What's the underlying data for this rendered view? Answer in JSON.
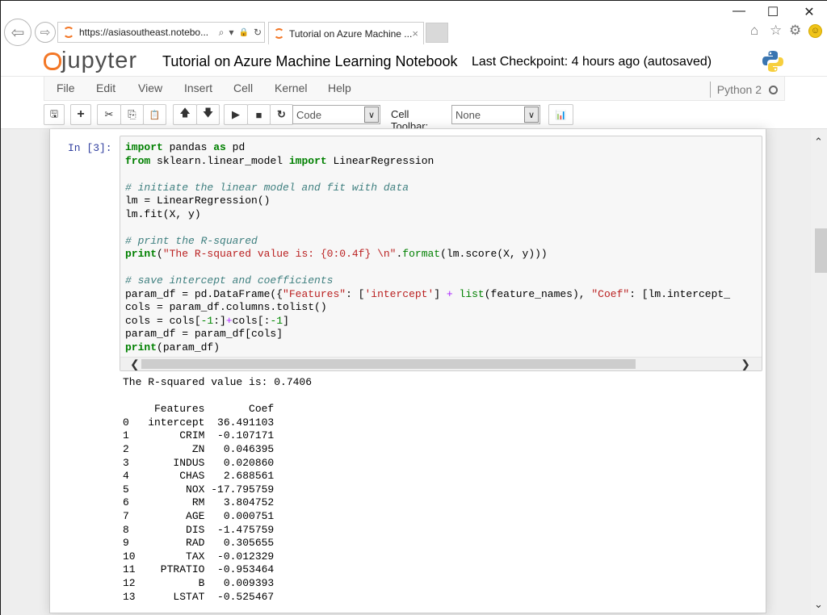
{
  "browser": {
    "url": "https://asiasoutheast.notebo...",
    "tab_title": "Tutorial on Azure Machine ...",
    "window_controls": {
      "minimize": "—",
      "maximize": "☐",
      "close": "✕"
    },
    "icons": {
      "back": "⇦",
      "forward": "⇨",
      "search": "⌕",
      "dropdown": "▾",
      "lock": "🔒",
      "refresh": "↻",
      "tab_close": "×",
      "home": "⌂",
      "favorites": "☆",
      "settings": "⚙",
      "feedback": "☺"
    }
  },
  "jupyter": {
    "logo_text": "jupyter",
    "notebook_title": "Tutorial on Azure Machine Learning Notebook",
    "checkpoint": "Last Checkpoint: 4 hours ago (autosaved)",
    "menu": [
      "File",
      "Edit",
      "View",
      "Insert",
      "Cell",
      "Kernel",
      "Help"
    ],
    "kernel_name": "Python 2",
    "toolbar": {
      "icons": {
        "save": "🖫",
        "add": "+",
        "cut": "✂",
        "copy": "⎘",
        "paste": "📋",
        "up": "🡅",
        "down": "🡇",
        "run": "▶",
        "stop": "■",
        "restart": "↻",
        "chart": "📊"
      },
      "cell_type": "Code",
      "cell_toolbar_label": "Cell Toolbar:",
      "cell_toolbar_value": "None",
      "dropdown_arrow": "∨"
    }
  },
  "cell": {
    "prompt": "In [3]:",
    "code_lines": [
      [
        {
          "t": "import",
          "c": "kw"
        },
        {
          "t": " pandas "
        },
        {
          "t": "as",
          "c": "kw"
        },
        {
          "t": " pd"
        }
      ],
      [
        {
          "t": "from",
          "c": "kw"
        },
        {
          "t": " sklearn.linear_model "
        },
        {
          "t": "import",
          "c": "kw"
        },
        {
          "t": " LinearRegression"
        }
      ],
      [],
      [
        {
          "t": "# initiate the linear model and fit with data",
          "c": "cm"
        }
      ],
      [
        {
          "t": "lm = LinearRegression()"
        }
      ],
      [
        {
          "t": "lm.fit(X, y)"
        }
      ],
      [],
      [
        {
          "t": "# print the R-squared",
          "c": "cm"
        }
      ],
      [
        {
          "t": "print",
          "c": "kw"
        },
        {
          "t": "("
        },
        {
          "t": "\"The R-squared value is: {0:0.4f} \\n\"",
          "c": "st"
        },
        {
          "t": "."
        },
        {
          "t": "format",
          "c": "nb"
        },
        {
          "t": "(lm.score(X, y)))"
        }
      ],
      [],
      [
        {
          "t": "# save intercept and coefficients",
          "c": "cm"
        }
      ],
      [
        {
          "t": "param_df = pd.DataFrame({"
        },
        {
          "t": "\"Features\"",
          "c": "st"
        },
        {
          "t": ": ["
        },
        {
          "t": "'intercept'",
          "c": "st"
        },
        {
          "t": "] "
        },
        {
          "t": "+",
          "c": "op"
        },
        {
          "t": " "
        },
        {
          "t": "list",
          "c": "nb"
        },
        {
          "t": "(feature_names), "
        },
        {
          "t": "\"Coef\"",
          "c": "st"
        },
        {
          "t": ": [lm.intercept_"
        }
      ],
      [
        {
          "t": "cols = param_df.columns.tolist()"
        }
      ],
      [
        {
          "t": "cols = cols["
        },
        {
          "t": "-1",
          "c": "nm"
        },
        {
          "t": ":]"
        },
        {
          "t": "+",
          "c": "op"
        },
        {
          "t": "cols[:"
        },
        {
          "t": "-1",
          "c": "nm"
        },
        {
          "t": "]"
        }
      ],
      [
        {
          "t": "param_df = param_df[cols]"
        }
      ],
      [
        {
          "t": "print",
          "c": "kw"
        },
        {
          "t": "(param_df)"
        }
      ]
    ],
    "hscroll": {
      "left": "❮",
      "right": "❯"
    },
    "output": {
      "r_squared_line": "The R-squared value is: 0.7406",
      "table_header": [
        "",
        "Features",
        "Coef"
      ],
      "rows": [
        [
          "0",
          "intercept",
          "36.491103"
        ],
        [
          "1",
          "CRIM",
          "-0.107171"
        ],
        [
          "2",
          "ZN",
          "0.046395"
        ],
        [
          "3",
          "INDUS",
          "0.020860"
        ],
        [
          "4",
          "CHAS",
          "2.688561"
        ],
        [
          "5",
          "NOX",
          "-17.795759"
        ],
        [
          "6",
          "RM",
          "3.804752"
        ],
        [
          "7",
          "AGE",
          "0.000751"
        ],
        [
          "8",
          "DIS",
          "-1.475759"
        ],
        [
          "9",
          "RAD",
          "0.305655"
        ],
        [
          "10",
          "TAX",
          "-0.012329"
        ],
        [
          "11",
          "PTRATIO",
          "-0.953464"
        ],
        [
          "12",
          "B",
          "0.009393"
        ],
        [
          "13",
          "LSTAT",
          "-0.525467"
        ]
      ]
    }
  },
  "scrollbar": {
    "up": "⌃",
    "down": "⌄"
  },
  "colors": {
    "accent": "#f37726",
    "prompt": "#303f9f",
    "keyword": "#008000",
    "comment": "#408080",
    "string": "#ba2121"
  }
}
